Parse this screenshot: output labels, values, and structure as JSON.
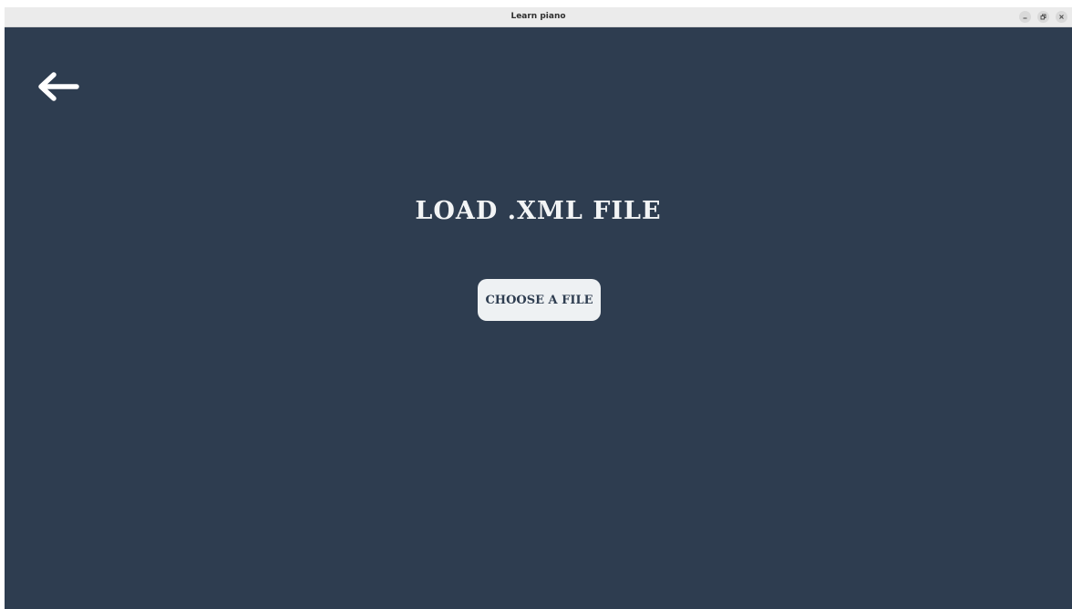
{
  "window": {
    "title": "Learn piano",
    "controls": {
      "minimize_icon": "minimize-icon",
      "maximize_icon": "restore-icon",
      "close_icon": "close-icon"
    }
  },
  "page": {
    "back_icon": "arrow-left-icon",
    "heading": "LOAD .XML FILE",
    "choose_button_label": "CHOOSE A FILE"
  },
  "colors": {
    "background": "#2e3d50",
    "foreground": "#f2f4f5",
    "button_bg": "#eef1f3",
    "titlebar_bg": "#ebebeb"
  }
}
